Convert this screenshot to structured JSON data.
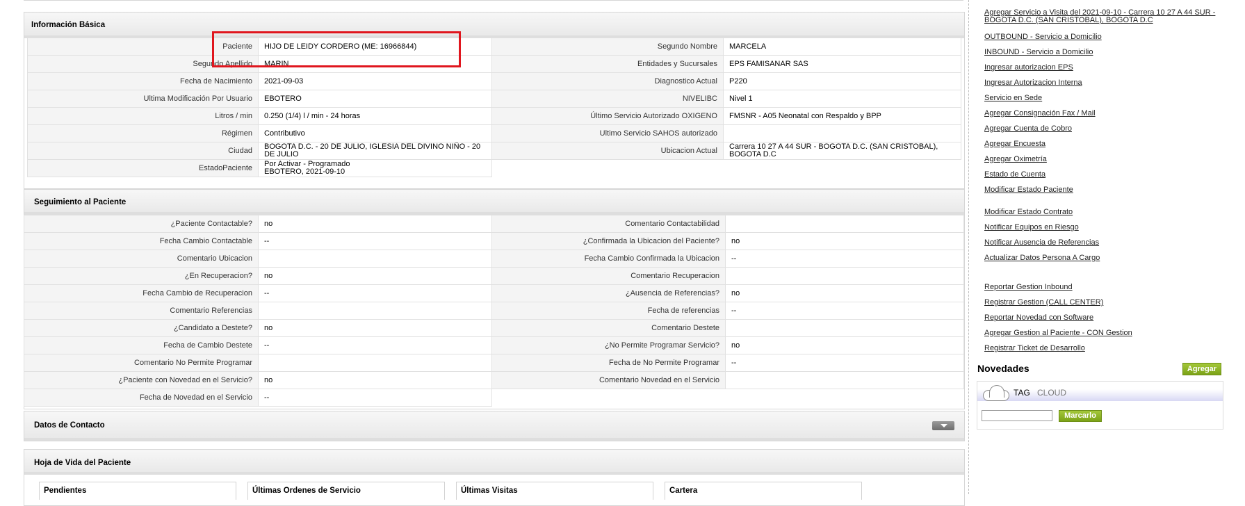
{
  "basic_info": {
    "title": "Información Básica",
    "rows": [
      {
        "l1": "Paciente",
        "v1": "HIJO DE LEIDY CORDERO (ME: 16966844)",
        "l2": "Segundo Nombre",
        "v2": "MARCELA"
      },
      {
        "l1": "Segundo Apellido",
        "v1": "MARIN",
        "l2": "Entidades y Sucursales",
        "v2": "EPS FAMISANAR SAS"
      },
      {
        "l1": "Fecha de Nacimiento",
        "v1": "2021-09-03",
        "l2": "Diagnostico Actual",
        "v2": "P220"
      },
      {
        "l1": "Ultima Modificación Por Usuario",
        "v1": "EBOTERO",
        "l2": "NIVELIBC",
        "v2": "Nivel 1"
      },
      {
        "l1": "Litros / min",
        "v1": "0.250 (1/4) l / min - 24 horas",
        "l2": "Último Servicio Autorizado OXIGENO",
        "v2": "FMSNR - A05 Neonatal con Respaldo y BPP"
      },
      {
        "l1": "Régimen",
        "v1": "Contributivo",
        "l2": "Ultimo Servicio SAHOS autorizado",
        "v2": ""
      },
      {
        "l1": "Ciudad",
        "v1": "BOGOTA D.C. - 20 DE JULIO, IGLESIA DEL DIVINO NIÑO - 20 DE JULIO",
        "l2": "Ubicacion Actual",
        "v2": "Carrera 10 27 A 44 SUR - BOGOTA D.C. (SAN CRISTOBAL), BOGOTA D.C"
      }
    ],
    "estado_label": "EstadoPaciente",
    "estado_line1": "Por Activar - Programado",
    "estado_line2": "EBOTERO, 2021-09-10"
  },
  "seguimiento": {
    "title": "Seguimiento al Paciente",
    "rows": [
      {
        "l1": "¿Paciente Contactable?",
        "v1": "no",
        "l2": "Comentario Contactabilidad",
        "v2": ""
      },
      {
        "l1": "Fecha Cambio Contactable",
        "v1": "--",
        "l2": "¿Confirmada la Ubicacion del Paciente?",
        "v2": "no"
      },
      {
        "l1": "Comentario Ubicacion",
        "v1": "",
        "l2": "Fecha Cambio Confirmada la Ubicacion",
        "v2": "--"
      },
      {
        "l1": "¿En Recuperacion?",
        "v1": "no",
        "l2": "Comentario Recuperacion",
        "v2": ""
      },
      {
        "l1": "Fecha Cambio de Recuperacion",
        "v1": "--",
        "l2": "¿Ausencia de Referencias?",
        "v2": "no"
      },
      {
        "l1": "Comentario Referencias",
        "v1": "",
        "l2": "Fecha de referencias",
        "v2": "--"
      },
      {
        "l1": "¿Candidato a Destete?",
        "v1": "no",
        "l2": "Comentario Destete",
        "v2": ""
      },
      {
        "l1": "Fecha de Cambio Destete",
        "v1": "--",
        "l2": "¿No Permite Programar Servicio?",
        "v2": "no"
      },
      {
        "l1": "Comentario No Permite Programar",
        "v1": "",
        "l2": "Fecha de No Permite Programar",
        "v2": "--"
      },
      {
        "l1": "¿Paciente con Novedad en el Servicio?",
        "v1": "no",
        "l2": "Comentario Novedad en el Servicio",
        "v2": ""
      }
    ],
    "last_label": "Fecha de Novedad en el Servicio",
    "last_value": "--"
  },
  "contacto": {
    "title": "Datos de Contacto"
  },
  "hoja": {
    "title": "Hoja de Vida del Paciente",
    "tabs": [
      "Pendientes",
      "Últimas Ordenes de Servicio",
      "Últimas Visitas",
      "Cartera"
    ]
  },
  "sidebar": {
    "visit_link_line1": "Agregar Servicio a Visita del 2021-09-10 - Carrera 10 27 A 44 SUR -",
    "visit_link_line2": "BOGOTA D.C. (SAN CRISTOBAL), BOGOTA D.C",
    "links_group1": [
      "OUTBOUND - Servicio a Domicilio",
      "INBOUND - Servicio a Domicilio",
      "Ingresar autorizacion EPS",
      "Ingresar Autorizacion Interna",
      "Servicio en Sede",
      "Agregar Consignación Fax / Mail",
      "Agregar Cuenta de Cobro",
      "Agregar Encuesta",
      "Agregar Oximetría",
      "Estado de Cuenta",
      "Modificar Estado Paciente"
    ],
    "links_group2": [
      "Modificar Estado Contrato",
      "Notificar Equipos en Riesgo",
      "Notificar Ausencia de Referencias",
      "Actualizar Datos Persona A Cargo"
    ],
    "links_group3": [
      "Reportar Gestion Inbound",
      "Registrar Gestion (CALL CENTER)",
      "Reportar Novedad con Software",
      "Agregar Gestion al Paciente - CON Gestion",
      "Registrar Ticket de Desarrollo"
    ],
    "novedades_title": "Novedades",
    "agregar_label": "Agregar",
    "tag_word1": "TAG",
    "tag_word2": "CLOUD",
    "marcarlo_label": "Marcarlo",
    "tag_input_value": ""
  },
  "colors": {
    "highlight": "#e0161e",
    "accent": "#8db72a"
  }
}
